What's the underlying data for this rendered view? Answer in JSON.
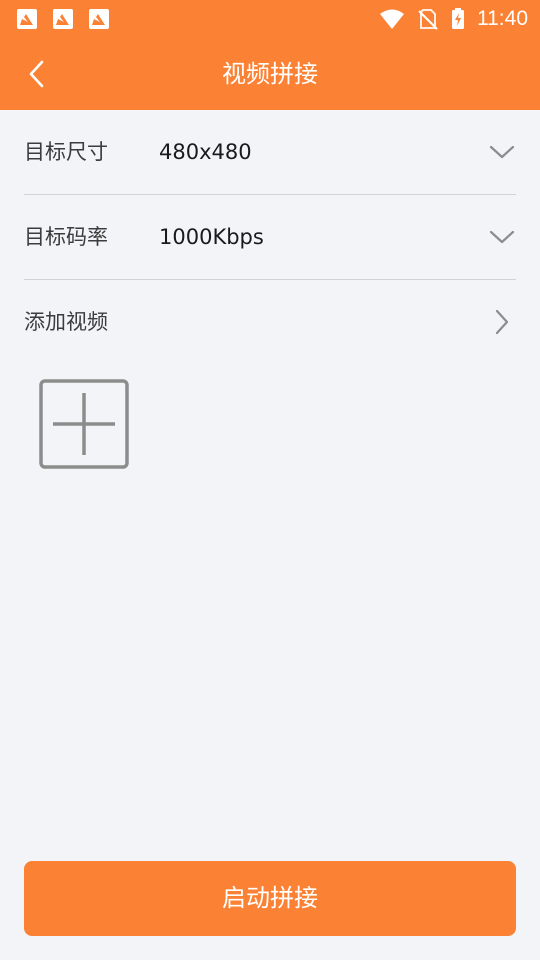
{
  "status_bar": {
    "time": "11:40",
    "notification_icons": [
      "app-notification-icon",
      "app-notification-icon",
      "app-notification-icon"
    ],
    "system_icons": [
      "wifi-icon",
      "no-sim-icon",
      "battery-charging-icon"
    ]
  },
  "app_bar": {
    "title": "视频拼接",
    "back_icon": "chevron-left-icon"
  },
  "settings": {
    "size": {
      "label": "目标尺寸",
      "value": "480x480",
      "icon": "chevron-down-icon"
    },
    "bitrate": {
      "label": "目标码率",
      "value": "1000Kbps",
      "icon": "chevron-down-icon"
    },
    "add_video": {
      "label": "添加视频",
      "icon": "chevron-right-icon"
    }
  },
  "add_tile": {
    "icon": "plus-icon"
  },
  "start_button": {
    "label": "启动拼接"
  },
  "colors": {
    "primary": "#fb8234",
    "background": "#f3f4f8",
    "divider": "#d3d3d5",
    "icon_gray": "#8c8c8c"
  }
}
